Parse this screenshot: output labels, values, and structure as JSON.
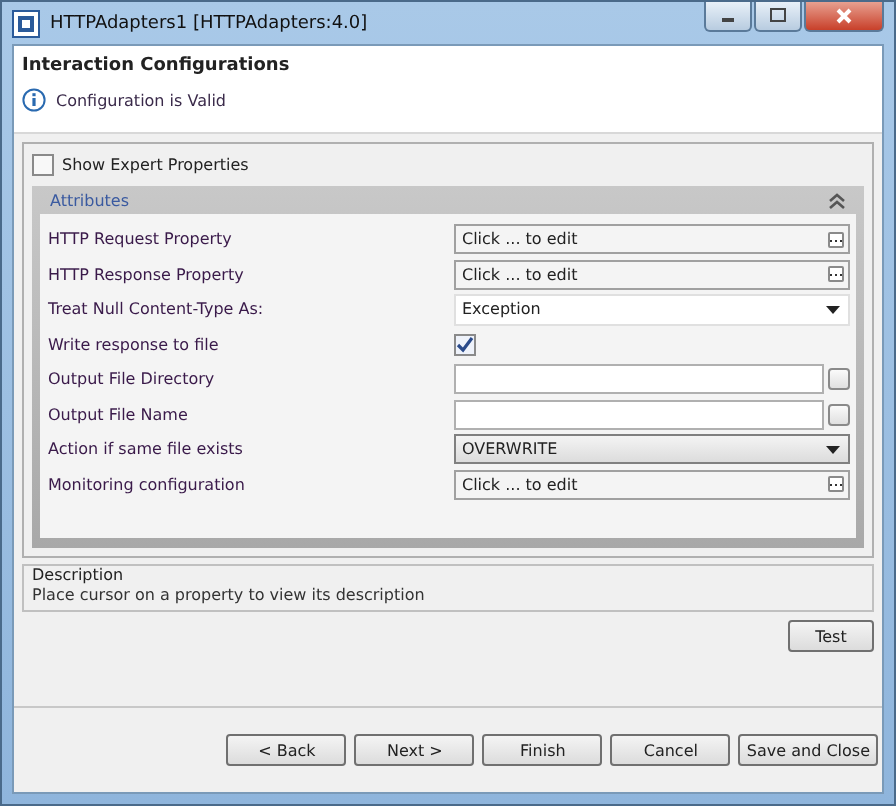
{
  "window": {
    "title": "HTTPAdapters1 [HTTPAdapters:4.0]"
  },
  "header": {
    "title": "Interaction Configurations",
    "status": "Configuration is Valid"
  },
  "show_expert": {
    "label": "Show Expert Properties",
    "checked": false
  },
  "section": {
    "title": "Attributes",
    "expanded": true
  },
  "properties": [
    {
      "kind": "edit",
      "label": "HTTP Request Property",
      "value": "Click ... to edit"
    },
    {
      "kind": "edit",
      "label": "HTTP Response Property",
      "value": "Click ... to edit"
    },
    {
      "kind": "select",
      "label": "Treat Null Content-Type As:",
      "value": "Exception"
    },
    {
      "kind": "checkbox",
      "label": "Write response to file",
      "checked": true
    },
    {
      "kind": "file",
      "label": "Output File Directory"
    },
    {
      "kind": "file",
      "label": "Output File Name"
    },
    {
      "kind": "combo",
      "label": "Action if same file exists",
      "value": "OVERWRITE"
    },
    {
      "kind": "edit",
      "label": "Monitoring configuration",
      "value": "Click ... to edit"
    }
  ],
  "description": {
    "title": "Description",
    "text": "Place cursor on a property to view its description"
  },
  "test_button": "Test",
  "buttons": [
    "< Back",
    "Next >",
    "Finish",
    "Cancel",
    "Save and Close"
  ]
}
